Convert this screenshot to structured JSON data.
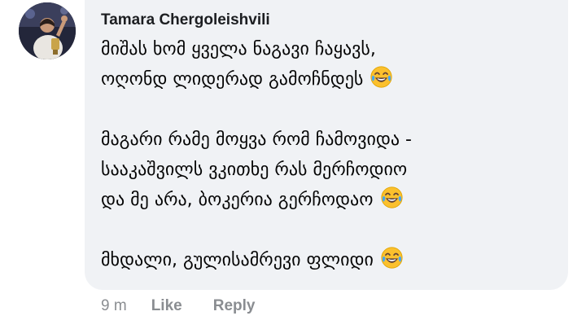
{
  "comment": {
    "author": "Tamara Chergoleishvili",
    "paragraphs": [
      {
        "lines": [
          {
            "text": "მიშას ხომ ყველა ნაგავი ჩაყავს,",
            "emoji": false
          },
          {
            "text": "ოღონდ ლიდერად გამოჩნდეს",
            "emoji": true
          }
        ]
      },
      {
        "lines": [
          {
            "text": "მაგარი რამე მოყვა რომ ჩამოვიდა -",
            "emoji": false
          },
          {
            "text": "სააკაშვილს ვკითხე რას მერჩოდიო",
            "emoji": false
          },
          {
            "text": "და მე არა, ბოკერია გერჩოდაო",
            "emoji": true
          }
        ]
      },
      {
        "lines": [
          {
            "text": "მხდალი, გულისამრევი ფლიდი",
            "emoji": true
          }
        ]
      }
    ],
    "emoji_icon": "face-with-tears-of-joy-icon",
    "time": "9 m",
    "like_label": "Like",
    "reply_label": "Reply"
  },
  "colors": {
    "bubble_bg": "#f0f2f5",
    "text": "#050505",
    "meta_text": "#8a8d91",
    "emoji_face": "#fbc02d"
  }
}
